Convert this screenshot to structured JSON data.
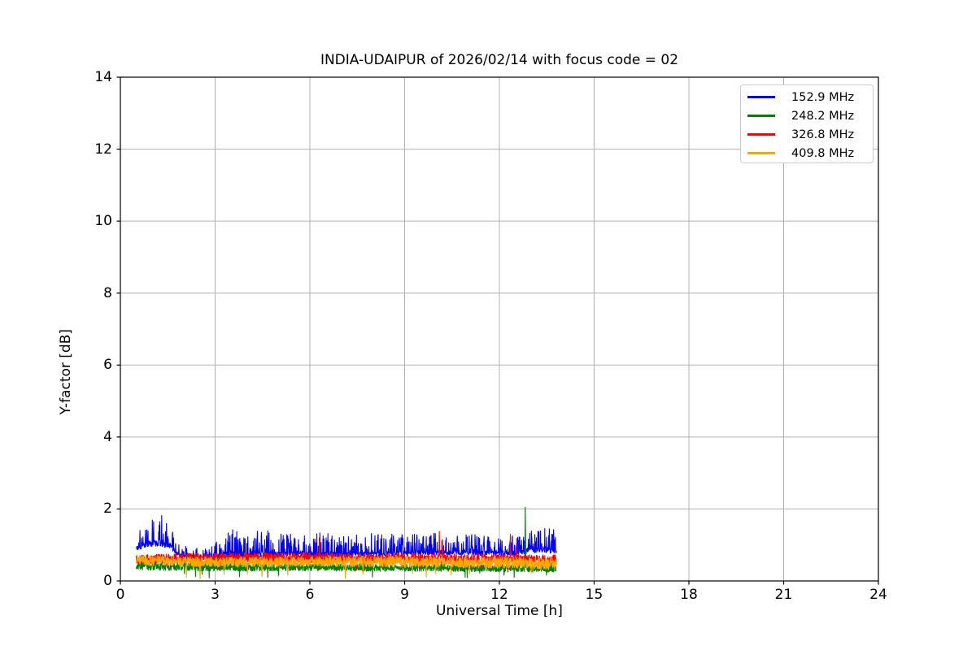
{
  "figure_title": "INDIA-UDAIPUR of 2026/02/14 with focus code = 02",
  "chart_data": {
    "type": "line",
    "title": "INDIA-UDAIPUR of 2026/02/14 with focus code = 02",
    "xlabel": "Universal Time [h]",
    "ylabel": "Y-factor [dB]",
    "xlim": [
      0,
      24
    ],
    "ylim": [
      0,
      14
    ],
    "xticks": [
      0,
      3,
      6,
      9,
      12,
      15,
      18,
      21,
      24
    ],
    "yticks": [
      0,
      2,
      4,
      6,
      8,
      10,
      12,
      14
    ],
    "grid": true,
    "grid_color": "#b0b0b0",
    "axis_color": "#000000",
    "background_color": "#ffffff",
    "legend_position": "upper right",
    "x_data_range": [
      0.5,
      13.8
    ],
    "sample_step_hours": 0.008,
    "description": "Noisy Y-factor time series for four frequencies; data present only from 0.5 h to 13.8 h UT. Blue trace fluctuates ~0.7-1.5 dB with spikes to ~1.9 dB near 1-1.5 h; green/red/orange overlap in a 0.3-0.8 dB band; isolated green spike to ~2.05 dB at 12.82 h; red spikes to ~1.2-1.4 dB near 6.3, 10.1 and 12.4 h; orange dips to ~0.05-0.2 dB at 2.5, 4.5, 7.1 and 11 h.",
    "series": [
      {
        "name": "152.9 MHz",
        "color": "#0000ff",
        "style": "spiky",
        "envelope": [
          [
            0.5,
            0.85,
            1.3
          ],
          [
            0.7,
            0.9,
            1.55
          ],
          [
            0.95,
            0.95,
            1.8
          ],
          [
            1.3,
            0.95,
            1.9
          ],
          [
            1.55,
            0.9,
            1.7
          ],
          [
            1.75,
            0.75,
            1.25
          ],
          [
            2.0,
            0.63,
            1.0
          ],
          [
            2.4,
            0.6,
            0.95
          ],
          [
            2.8,
            0.58,
            0.95
          ],
          [
            3.2,
            0.62,
            1.2
          ],
          [
            3.5,
            0.65,
            1.5
          ],
          [
            4.0,
            0.62,
            1.25
          ],
          [
            4.5,
            0.66,
            1.45
          ],
          [
            5.0,
            0.65,
            1.3
          ],
          [
            5.6,
            0.68,
            1.42
          ],
          [
            6.2,
            0.66,
            1.35
          ],
          [
            7.0,
            0.66,
            1.28
          ],
          [
            7.8,
            0.68,
            1.32
          ],
          [
            8.6,
            0.7,
            1.32
          ],
          [
            9.4,
            0.72,
            1.3
          ],
          [
            10.2,
            0.72,
            1.35
          ],
          [
            11.0,
            0.72,
            1.35
          ],
          [
            11.8,
            0.7,
            1.28
          ],
          [
            12.4,
            0.7,
            1.3
          ],
          [
            12.9,
            0.75,
            1.45
          ],
          [
            13.3,
            0.8,
            1.55
          ],
          [
            13.8,
            0.75,
            1.45
          ]
        ],
        "events": []
      },
      {
        "name": "248.2 MHz",
        "color": "#008000",
        "style": "band",
        "envelope": [
          [
            0.5,
            0.3,
            0.55
          ],
          [
            2.0,
            0.28,
            0.52
          ],
          [
            4.0,
            0.27,
            0.5
          ],
          [
            6.0,
            0.28,
            0.5
          ],
          [
            8.0,
            0.27,
            0.48
          ],
          [
            10.0,
            0.26,
            0.48
          ],
          [
            12.0,
            0.25,
            0.46
          ],
          [
            13.8,
            0.24,
            0.45
          ]
        ],
        "dips": {
          "prob": 0.008,
          "min": 0.08,
          "max": 0.22
        },
        "events": [
          {
            "x": 12.82,
            "value": 2.05
          }
        ]
      },
      {
        "name": "326.8 MHz",
        "color": "#ff0000",
        "style": "band",
        "envelope": [
          [
            0.5,
            0.45,
            0.72
          ],
          [
            1.5,
            0.5,
            0.75
          ],
          [
            3.0,
            0.5,
            0.78
          ],
          [
            5.0,
            0.5,
            0.78
          ],
          [
            7.0,
            0.5,
            0.77
          ],
          [
            9.0,
            0.49,
            0.76
          ],
          [
            11.0,
            0.48,
            0.75
          ],
          [
            12.5,
            0.47,
            0.74
          ],
          [
            13.8,
            0.45,
            0.72
          ]
        ],
        "dips": {
          "prob": 0.006,
          "min": 0.28,
          "max": 0.4
        },
        "events": [
          {
            "x": 6.3,
            "value": 1.2
          },
          {
            "x": 10.1,
            "value": 1.38
          },
          {
            "x": 10.2,
            "value": 1.15
          },
          {
            "x": 12.35,
            "value": 1.3
          },
          {
            "x": 12.55,
            "value": 1.18
          }
        ]
      },
      {
        "name": "409.8 MHz",
        "color": "#ffa500",
        "style": "band",
        "envelope": [
          [
            0.5,
            0.45,
            0.73
          ],
          [
            1.2,
            0.42,
            0.7
          ],
          [
            2.0,
            0.4,
            0.68
          ],
          [
            3.0,
            0.38,
            0.66
          ],
          [
            4.5,
            0.38,
            0.67
          ],
          [
            6.0,
            0.4,
            0.68
          ],
          [
            7.5,
            0.38,
            0.68
          ],
          [
            9.0,
            0.38,
            0.68
          ],
          [
            10.5,
            0.37,
            0.67
          ],
          [
            11.5,
            0.36,
            0.66
          ],
          [
            12.5,
            0.34,
            0.66
          ],
          [
            13.8,
            0.3,
            0.64
          ]
        ],
        "dips": {
          "prob": 0.005,
          "min": 0.1,
          "max": 0.25
        },
        "events": [
          {
            "x": 2.52,
            "value": 0.06
          },
          {
            "x": 4.48,
            "value": 0.12
          },
          {
            "x": 5.3,
            "value": 0.16
          },
          {
            "x": 7.12,
            "value": 0.07
          },
          {
            "x": 11.05,
            "value": 0.2
          },
          {
            "x": 13.0,
            "value": 0.22
          }
        ]
      }
    ]
  }
}
